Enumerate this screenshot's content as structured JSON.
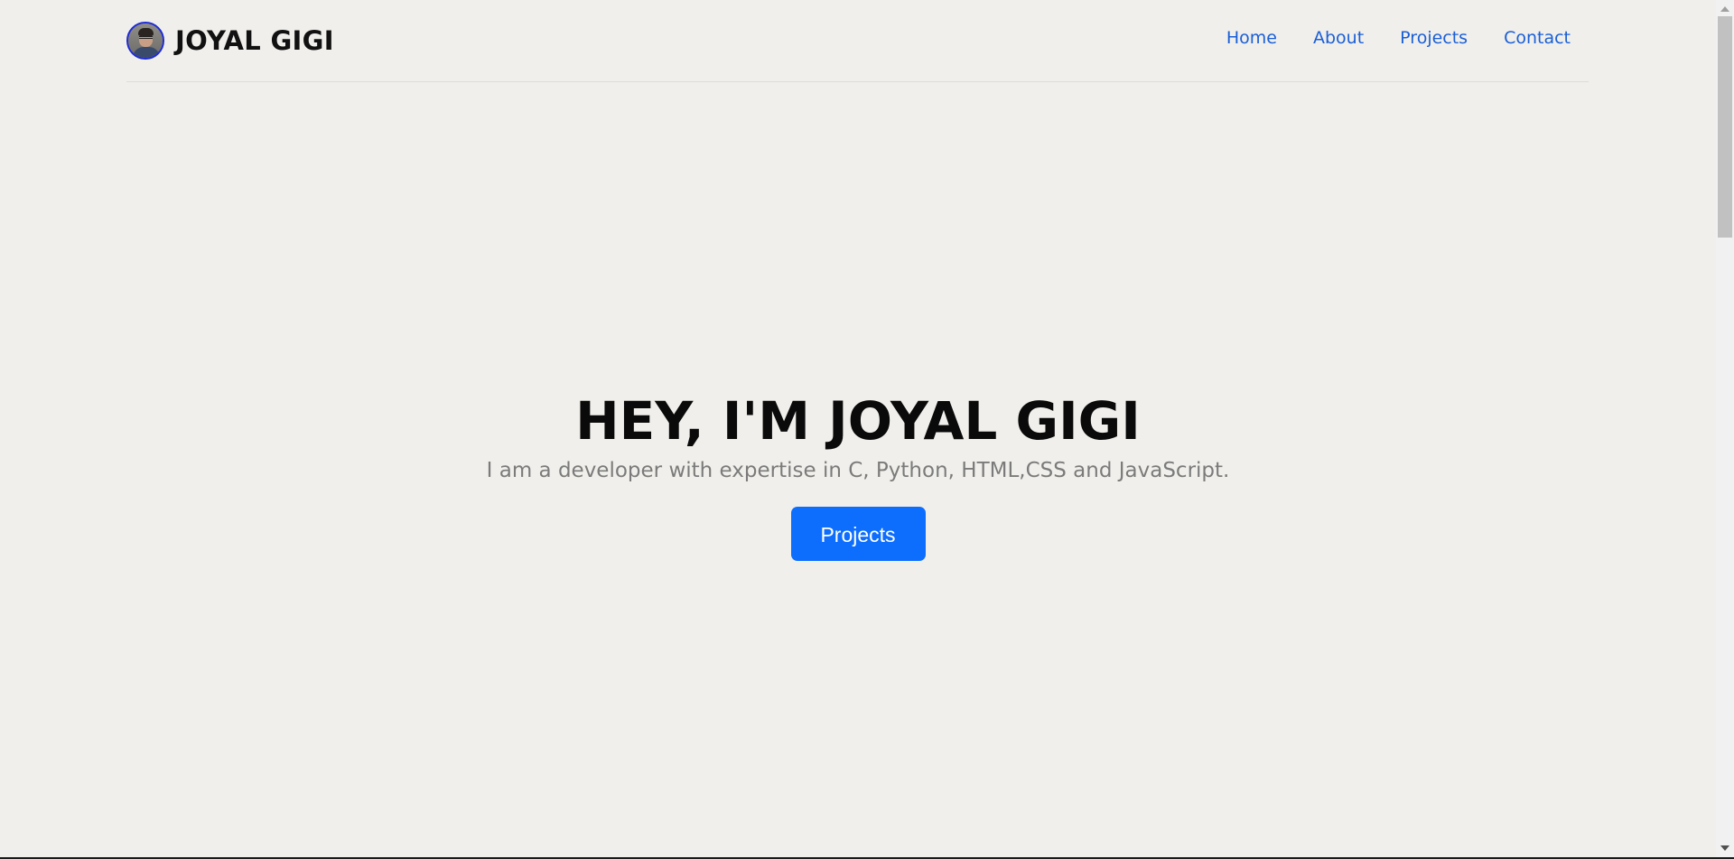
{
  "header": {
    "brand_name": "JOYAL GIGI",
    "avatar_alt": "profile photo",
    "nav": [
      {
        "label": "Home"
      },
      {
        "label": "About"
      },
      {
        "label": "Projects"
      },
      {
        "label": "Contact"
      }
    ]
  },
  "hero": {
    "title": "HEY, I'M JOYAL GIGI",
    "subtitle": "I am a developer with expertise in C, Python, HTML,CSS and JavaScript.",
    "cta_label": "Projects"
  },
  "colors": {
    "background": "#f0efeb",
    "link": "#1a5fd6",
    "button": "#0d6efd",
    "avatar_border": "#1e2bd6"
  },
  "icons": [
    "scroll-up-arrow-icon",
    "scroll-down-arrow-icon"
  ]
}
